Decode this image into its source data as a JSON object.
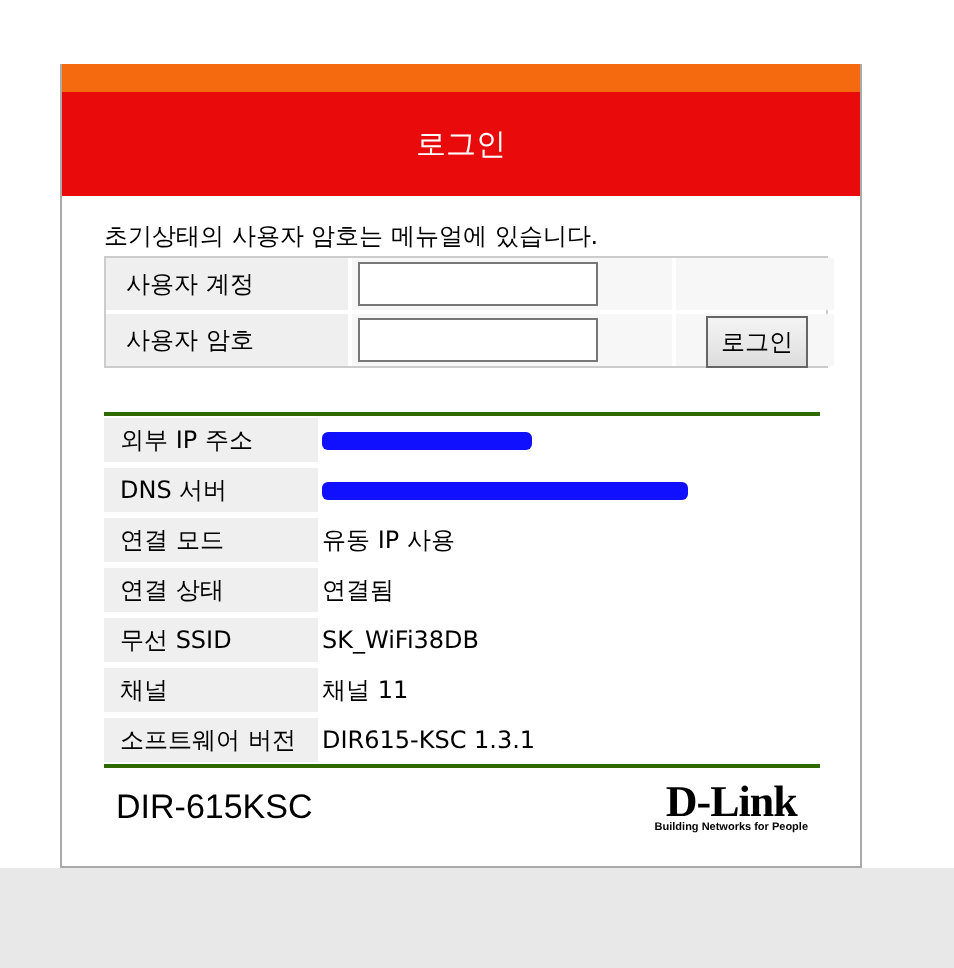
{
  "header": {
    "title": "로그인"
  },
  "login": {
    "note": "초기상태의 사용자 암호는 메뉴얼에 있습니다.",
    "fields": [
      {
        "label": "사용자 계정"
      },
      {
        "label": "사용자 암호"
      }
    ],
    "button": "로그인"
  },
  "status": [
    {
      "label": "외부 IP 주소",
      "kind": "scribbled"
    },
    {
      "label": "DNS 서버",
      "kind": "scribbled"
    },
    {
      "label": "연결 모드",
      "value": "유동 IP 사용",
      "kind": "text"
    },
    {
      "label": "연결 상태",
      "value": "연결됨",
      "kind": "text"
    },
    {
      "label": "무선 SSID",
      "value": "SK_WiFi38DB",
      "kind": "text"
    },
    {
      "label": "채널",
      "value": "채널 11",
      "kind": "text"
    },
    {
      "label": "소프트웨어 버전",
      "value": "DIR615-KSC 1.3.1",
      "kind": "text"
    }
  ],
  "footer": {
    "model": "DIR-615KSC",
    "brand": "D-Link",
    "tagline": "Building Networks for People"
  }
}
